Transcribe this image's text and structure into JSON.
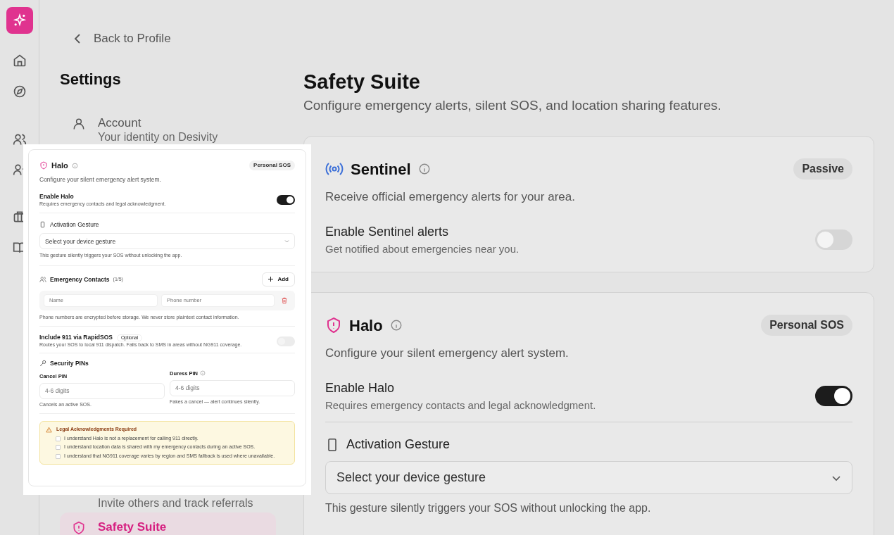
{
  "back_link": "Back to Profile",
  "sidebar": {
    "title": "Settings",
    "items": [
      {
        "kind": "account",
        "label": "Account",
        "description": "Your identity on Desivity",
        "selected": false
      },
      {
        "kind": "referrals",
        "description": "Invite others and track referrals",
        "selected": false
      },
      {
        "kind": "safety",
        "label": "Safety Suite",
        "selected": true
      }
    ]
  },
  "page": {
    "title": "Safety Suite",
    "subtitle": "Configure emergency alerts, silent SOS, and location sharing features."
  },
  "sentinel": {
    "title": "Sentinel",
    "badge": "Passive",
    "description": "Receive official emergency alerts for your area.",
    "toggle": {
      "label": "Enable Sentinel alerts",
      "hint": "Get notified about emergencies near you.",
      "on": false
    }
  },
  "halo": {
    "title": "Halo",
    "badge": "Personal SOS",
    "description": "Configure your silent emergency alert system.",
    "toggle": {
      "label": "Enable Halo",
      "hint": "Requires emergency contacts and legal acknowledgment.",
      "on": true
    },
    "gesture": {
      "label": "Activation Gesture",
      "placeholder": "Select your device gesture",
      "hint": "This gesture silently triggers your SOS without unlocking the app."
    }
  },
  "halo_preview": {
    "title": "Halo",
    "badge": "Personal SOS",
    "description": "Configure your silent emergency alert system.",
    "toggle": {
      "label": "Enable Halo",
      "hint": "Requires emergency contacts and legal acknowledgment.",
      "on": true
    },
    "gesture": {
      "label": "Activation Gesture",
      "placeholder": "Select your device gesture",
      "hint": "This gesture silently triggers your SOS without unlocking the app."
    },
    "contacts": {
      "label": "Emergency Contacts",
      "count": "(1/5)",
      "add": "Add",
      "rows": [
        {
          "name_placeholder": "Name",
          "phone_placeholder": "Phone number"
        }
      ],
      "note": "Phone numbers are encrypted before storage. We never store plaintext contact information."
    },
    "rapidsos": {
      "label": "Include 911 via RapidSOS",
      "badge": "Optional",
      "hint": "Routes your SOS to local 911 dispatch. Falls back to SMS in areas without NG911 coverage.",
      "on": false
    },
    "pins": {
      "label": "Security PINs",
      "fields": [
        {
          "label": "Cancel PIN",
          "info": false,
          "placeholder": "4-6 digits",
          "hint": "Cancels an active SOS."
        },
        {
          "label": "Duress PIN",
          "info": true,
          "placeholder": "4-6 digits",
          "hint": "Fakes a cancel — alert continues silently."
        }
      ]
    },
    "legal": {
      "title": "Legal Acknowledgments Required",
      "items": [
        {
          "text": "I understand Halo is not a replacement for calling 911 directly.",
          "checked": false
        },
        {
          "text": "I understand location data is shared with my emergency contacts during an active SOS.",
          "checked": false
        },
        {
          "text": "I understand that NG911 coverage varies by region and SMS fallback is used where unavailable.",
          "checked": false
        }
      ]
    }
  }
}
